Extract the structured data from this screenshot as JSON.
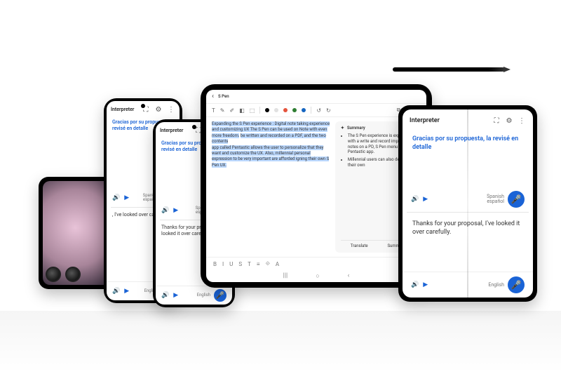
{
  "interpreter": {
    "title": "Interpreter",
    "top_text": "Gracias por su propuesta, la revisé en detalle",
    "bottom_text_short": "Thanks for your proposal, I've looked it over carefully.",
    "bottom_text_partial": ", I've looked over carefully.",
    "lang_top": "Spanish",
    "lang_top_sub": "español",
    "lang_bottom": "English",
    "icons": {
      "expand": "⛶",
      "settings": "⚙",
      "more": "⋮",
      "play": "▶",
      "speaker": "🔊",
      "mic": "🎤"
    }
  },
  "notes": {
    "title": "S Pen",
    "editor_text_1": "Expanding the S Pen experience : Digital note taking experience and customizing UX The S Pen can be used on Note with even more freedom.",
    "editor_text_2": "be written and recorded on a PDF, and the two contents",
    "editor_text_3": "app called Pentastic allows the user to personalize that they want and customize the UX. Also, millennial personal expression to be very important are afforded igning their own S Pen UX.",
    "summary_title": "Summary",
    "summary_items": [
      "The S Pen experience is expanding with a write and record important notes on a PD, S Pen menu with the Pentastic app.",
      "Millennial users can also design their own"
    ],
    "footer_left": "Translate",
    "footer_right": "Summary",
    "toolbar_labels": [
      "T",
      "✎",
      "✐",
      "◧",
      "⬚",
      "↺",
      "↻"
    ],
    "format_labels": [
      "B",
      "I",
      "U",
      "S",
      "T",
      "≡",
      "⟐",
      "A"
    ]
  }
}
